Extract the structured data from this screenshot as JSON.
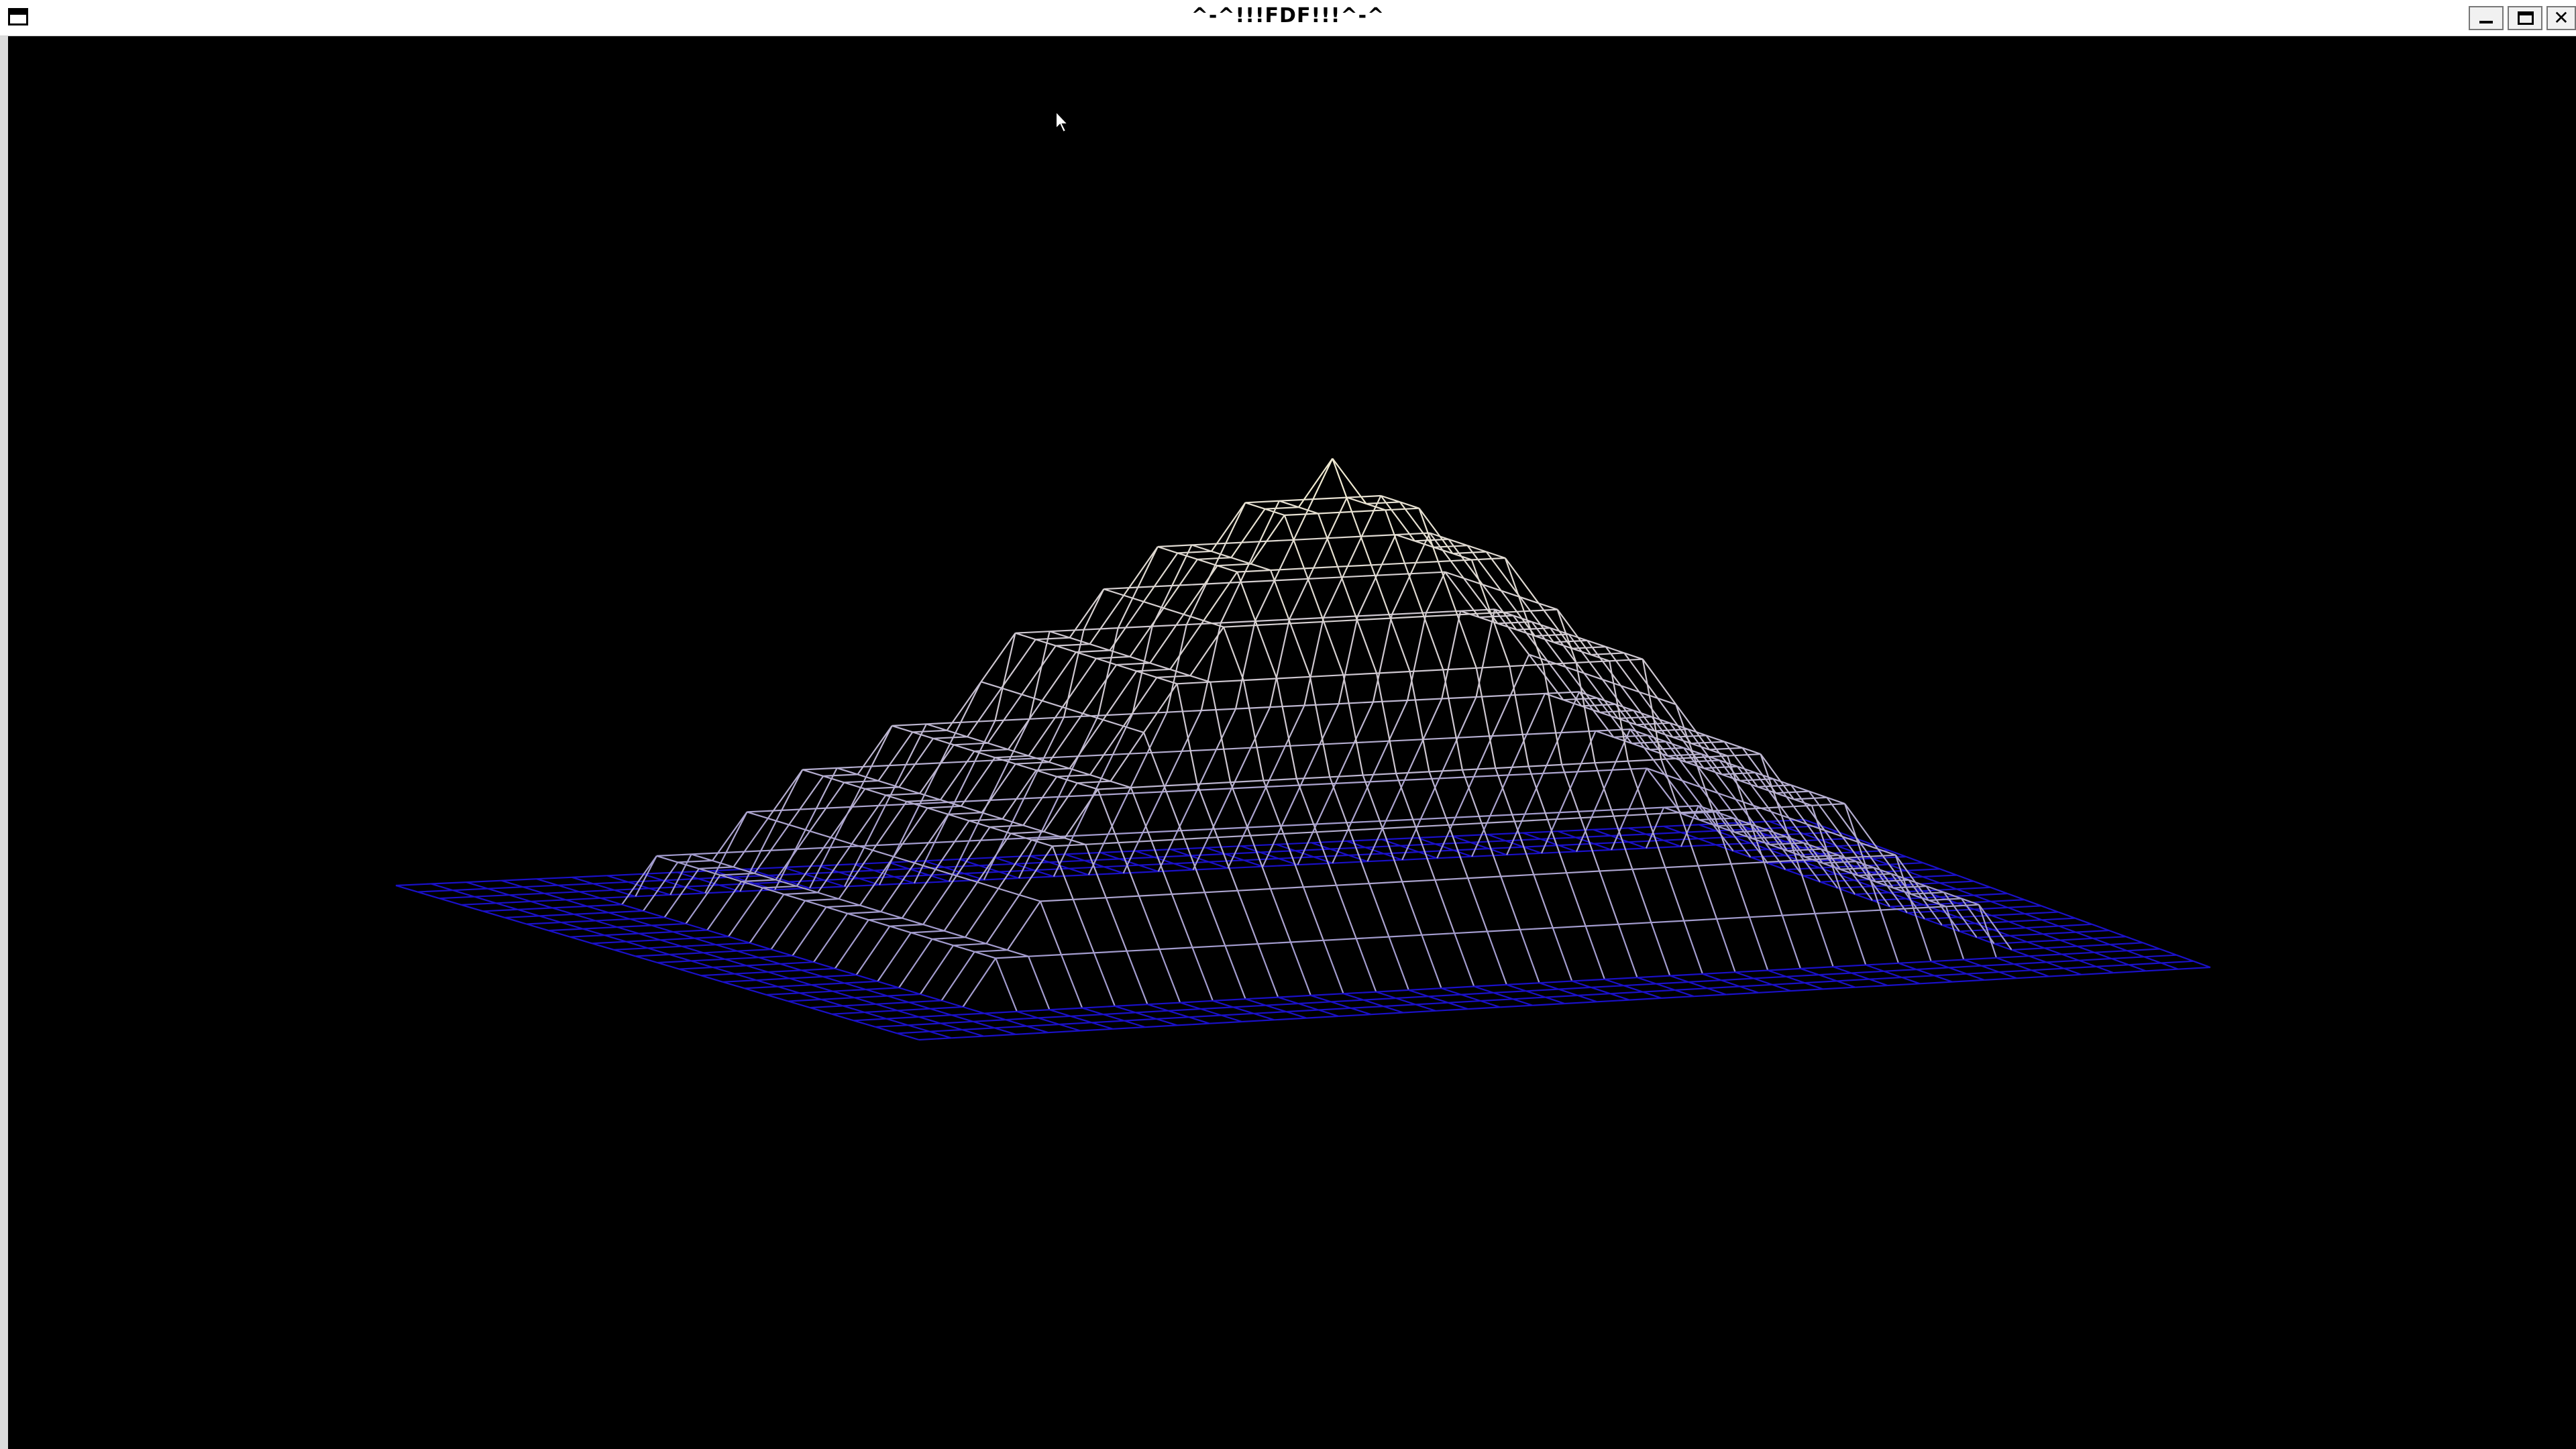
{
  "window": {
    "title": "^-^!!!FDF!!!^-^",
    "menu_icon": "window-menu-icon",
    "minimize_icon": "minimize-icon",
    "maximize_icon": "maximize-icon",
    "close_icon": "close-icon",
    "close_glyph": "✕"
  },
  "scene": {
    "kind": "isometric wireframe height map",
    "grid_columns": 40,
    "grid_rows": 24,
    "base_height": 0,
    "peak_height": 10,
    "base_color": "#1a10c8",
    "peak_color": "#f0ead2",
    "background_color": "#000000"
  },
  "cursor": {
    "icon": "mouse-pointer-icon"
  }
}
